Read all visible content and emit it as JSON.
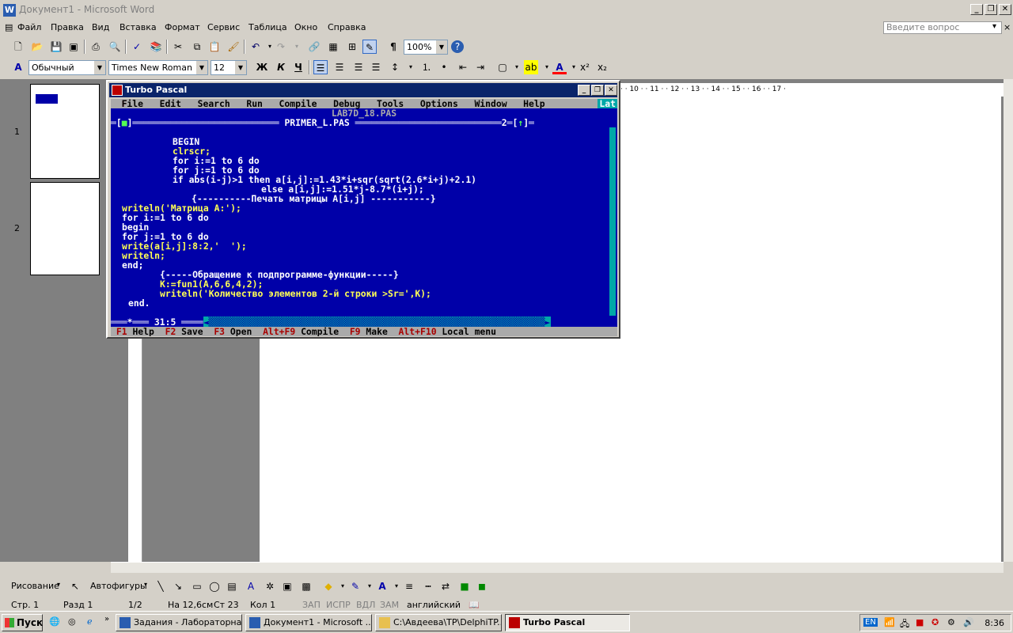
{
  "window": {
    "title": "Документ1 - Microsoft Word"
  },
  "menu": [
    "Файл",
    "Правка",
    "Вид",
    "Вставка",
    "Формат",
    "Сервис",
    "Таблица",
    "Окно",
    "Справка"
  ],
  "ask_placeholder": "Введите вопрос",
  "toolbar": {
    "zoom": "100%",
    "pilcrow": "¶"
  },
  "format": {
    "style": "Обычный",
    "font": "Times New Roman",
    "size": "12",
    "bold": "Ж",
    "italic": "К",
    "underline": "Ч"
  },
  "thumbs": [
    {
      "num": "1"
    },
    {
      "num": "2"
    }
  ],
  "ruler": {
    "h": "· · 10 · · 11 · · 12 · · 13 · · 14 · · 15 · · 16 · · 17 ·"
  },
  "tp": {
    "title": "Turbo Pascal",
    "menu": {
      "file": "File",
      "edit": "Edit",
      "search": "Search",
      "run": "Run",
      "compile": "Compile",
      "debug": "Debug",
      "tools": "Tools",
      "options": "Options",
      "window": "Window",
      "help": "Help",
      "lat": "Lat"
    },
    "frame_top1": "LAB7D_18.PAS",
    "frame_top2": "PRIMER_L.PAS",
    "cursor_pos": "31:5",
    "code": [
      "BEGIN",
      "clrscr;",
      "for i:=1 to 6 do",
      "for j:=1 to 6 do",
      "if abs(i-j)>1 then a[i,j]:=1.43*i+sqr(sqrt(2.6*i+j)+2.1)",
      "else a[i,j]:=1.51*j-8.7*(i+j);",
      "{----------Печать матрицы A[i,j] -----------}",
      "writeln('Матрица A:');",
      "for i:=1 to 6 do",
      "begin",
      "for j:=1 to 6 do",
      "write(a[i,j]:8:2,'  ');",
      "writeln;",
      "end;",
      "{-----Обращение к подпрограмме-функции-----}",
      "K:=fun1(A,6,6,4,2);",
      "writeln('Количество элементов 2-й строки >Sr=',K);",
      "end."
    ],
    "status": {
      "f1": "F1",
      "help": "Help",
      "f2": "F2",
      "save": "Save",
      "f3": "F3",
      "open": "Open",
      "altf9": "Alt+F9",
      "compile": "Compile",
      "f9": "F9",
      "make": "Make",
      "altf10": "Alt+F10",
      "local": "Local menu"
    }
  },
  "drawing": {
    "draw": "Рисование",
    "autoshapes": "Автофигуры"
  },
  "status": {
    "page": "Стр. 1",
    "section": "Разд 1",
    "pages": "1/2",
    "at": "На 12,6см",
    "line": "Ст 23",
    "col": "Кол 1",
    "rec": "ЗАП",
    "trk": "ИСПР",
    "ext": "ВДЛ",
    "ovr": "ЗАМ",
    "lang": "английский"
  },
  "taskbar": {
    "start": "Пуск",
    "tasks": [
      "Задания - Лабораторна...",
      "Документ1 - Microsoft ...",
      "C:\\Авдеева\\TP\\DelphiTP...",
      "Turbo Pascal"
    ],
    "lang": "EN",
    "clock": "8:36"
  }
}
